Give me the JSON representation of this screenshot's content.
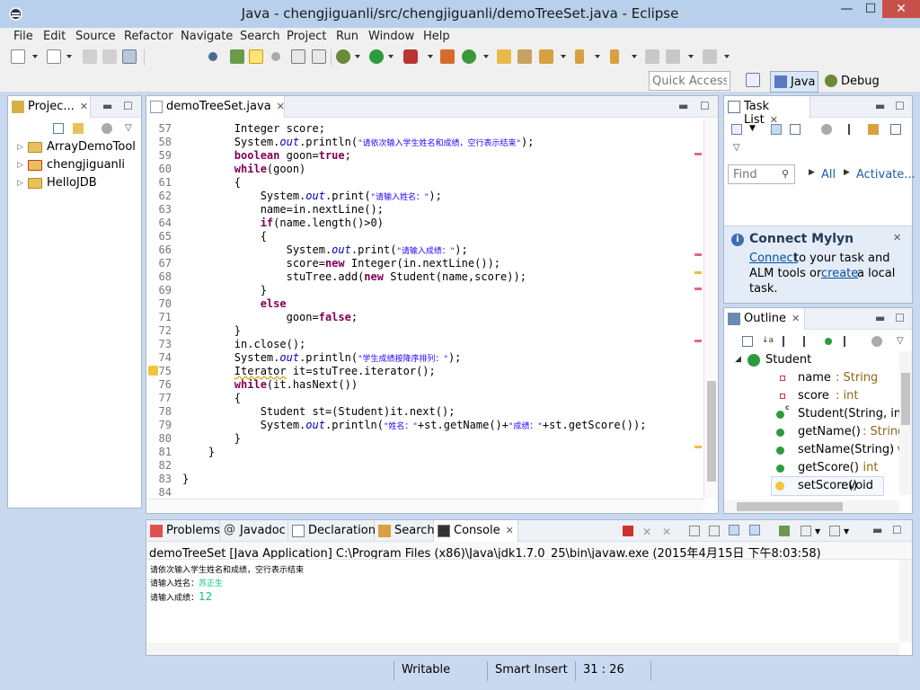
{
  "window": {
    "title": "Java - chengjiguanli/src/chengjiguanli/demoTreeSet.java - Eclipse",
    "minimize": "—",
    "maximize": "☐",
    "close": "✕"
  },
  "menu": [
    "File",
    "Edit",
    "Source",
    "Refactor",
    "Navigate",
    "Search",
    "Project",
    "Run",
    "Window",
    "Help"
  ],
  "toolbar": {
    "quick_access_placeholder": "Quick Access",
    "perspectives": [
      "Java",
      "Debug"
    ]
  },
  "project_explorer": {
    "tab_label": "Projec...",
    "items": [
      "ArrayDemoTool",
      "chengjiguanli",
      "HelloJDB"
    ]
  },
  "editor": {
    "tab_label": "demoTreeSet.java",
    "lines": [
      {
        "no": "57",
        "text": "        Integer score;"
      },
      {
        "no": "58",
        "text": "        System.out.println(\"请依次输入学生姓名和成绩，空行表示结束\");"
      },
      {
        "no": "59",
        "text": "        boolean goon=true;"
      },
      {
        "no": "60",
        "text": "        while(goon)"
      },
      {
        "no": "61",
        "text": "        {"
      },
      {
        "no": "62",
        "text": "            System.out.print(\"请输入姓名：\");"
      },
      {
        "no": "63",
        "text": "            name=in.nextLine();"
      },
      {
        "no": "64",
        "text": "            if(name.length()>0)"
      },
      {
        "no": "65",
        "text": "            {"
      },
      {
        "no": "66",
        "text": "                System.out.print(\"请输入成绩：\");"
      },
      {
        "no": "67",
        "text": "                score=new Integer(in.nextLine());"
      },
      {
        "no": "68",
        "text": "                stuTree.add(new Student(name,score));"
      },
      {
        "no": "69",
        "text": "            }"
      },
      {
        "no": "70",
        "text": "            else"
      },
      {
        "no": "71",
        "text": "                goon=false;"
      },
      {
        "no": "72",
        "text": "        }"
      },
      {
        "no": "73",
        "text": "        in.close();"
      },
      {
        "no": "74",
        "text": "        System.out.println(\"学生成绩按降序排列：\");"
      },
      {
        "no": "75",
        "text": "        Iterator it=stuTree.iterator();"
      },
      {
        "no": "76",
        "text": "        while(it.hasNext())"
      },
      {
        "no": "77",
        "text": "        {"
      },
      {
        "no": "78",
        "text": "            Student st=(Student)it.next();"
      },
      {
        "no": "79",
        "text": "            System.out.println(\"姓名：\"+st.getName()+\"成绩：\"+st.getScore());"
      },
      {
        "no": "80",
        "text": "        }"
      },
      {
        "no": "81",
        "text": "    }"
      },
      {
        "no": "82",
        "text": ""
      },
      {
        "no": "83",
        "text": "}"
      },
      {
        "no": "84",
        "text": ""
      }
    ]
  },
  "task_list": {
    "tab_label": "Task List",
    "find_placeholder": "Find",
    "all_label": "All",
    "activate_label": "Activate...",
    "mylyn": {
      "title": "Connect Mylyn",
      "link_connect": "Connect",
      "text_1": "to your task and",
      "text_2": "ALM tools or",
      "link_create": "create",
      "text_3": "a local",
      "text_4": "task."
    }
  },
  "outline": {
    "tab_label": "Outline",
    "class_name": "Student",
    "items": [
      {
        "name": "name",
        "type": ": String"
      },
      {
        "name": "score",
        "type": ": int"
      },
      {
        "name": "Student(String, int)",
        "type": ""
      },
      {
        "name": "getName()",
        "type": ": String"
      },
      {
        "name": "setName(String)",
        "type": ": v"
      },
      {
        "name": "getScore()",
        "type": ": int"
      },
      {
        "name": "setScore()",
        "type": ": void"
      }
    ]
  },
  "bottom_tabs": [
    "Problems",
    "Javadoc",
    "Declaration",
    "Search",
    "Console"
  ],
  "console": {
    "header": "demoTreeSet [Java Application] C:\\Program Files (x86)\\Java\\jdk1.7.0_25\\bin\\javaw.exe (2015年4月15日 下午8:03:58)",
    "line_1": "请依次输入学生姓名和成绩，空行表示结束",
    "line_2_label": "请输入姓名：",
    "line_2_value": "苏正生",
    "line_3_label": "请输入成绩：",
    "line_3_value": "12"
  },
  "status": {
    "writable": "Writable",
    "insert_mode": "Smart Insert",
    "position": "31 : 26"
  },
  "colors": {
    "title_bg": "#b8d0ec",
    "panel_border": "#a9b6c6",
    "keyword": "#7f0055",
    "field": "#0000c0",
    "string": "#2a00ff",
    "console_input": "#00c87d"
  }
}
